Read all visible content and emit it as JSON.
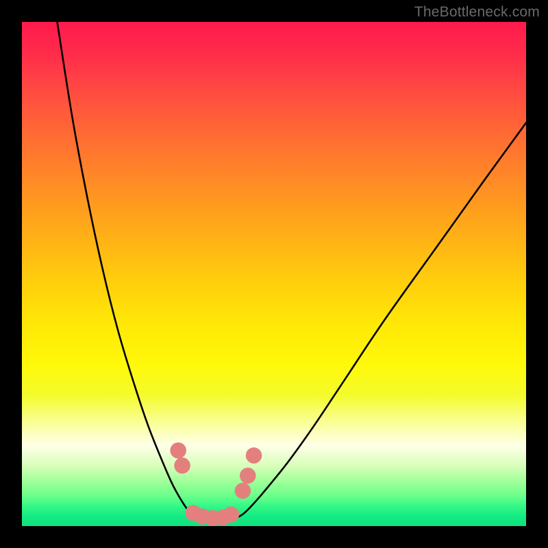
{
  "watermark": {
    "text": "TheBottleneck.com"
  },
  "chart_data": {
    "type": "line",
    "title": "",
    "xlabel": "",
    "ylabel": "",
    "xlim": [
      0,
      100
    ],
    "ylim": [
      0,
      100
    ],
    "grid": false,
    "legend": false,
    "series": [
      {
        "name": "left-curve",
        "x": [
          7,
          10,
          13,
          16,
          19,
          22,
          25,
          28,
          30,
          32,
          33.5,
          35
        ],
        "values": [
          100,
          81,
          65,
          51,
          39,
          29,
          20,
          12.5,
          8,
          4.5,
          2.5,
          1.3
        ]
      },
      {
        "name": "right-curve",
        "x": [
          42,
          44,
          46,
          49,
          53,
          58,
          64,
          72,
          82,
          92,
          100
        ],
        "values": [
          1.3,
          2.5,
          4.5,
          8,
          13,
          20,
          29,
          41,
          55,
          69,
          80
        ]
      },
      {
        "name": "valley-floor",
        "x": [
          35,
          37,
          39,
          41,
          42
        ],
        "values": [
          1.3,
          1.0,
          1.0,
          1.0,
          1.3
        ]
      }
    ],
    "markers": {
      "name": "pink-dots",
      "color": "#e3807e",
      "radius_pct": 1.6,
      "points": [
        {
          "x": 31.0,
          "y": 15.0
        },
        {
          "x": 31.8,
          "y": 12.0
        },
        {
          "x": 34.0,
          "y": 2.6
        },
        {
          "x": 35.8,
          "y": 1.9
        },
        {
          "x": 37.8,
          "y": 1.6
        },
        {
          "x": 39.8,
          "y": 1.7
        },
        {
          "x": 41.5,
          "y": 2.3
        },
        {
          "x": 43.8,
          "y": 7.0
        },
        {
          "x": 44.8,
          "y": 10.0
        },
        {
          "x": 46.0,
          "y": 14.0
        }
      ]
    }
  }
}
